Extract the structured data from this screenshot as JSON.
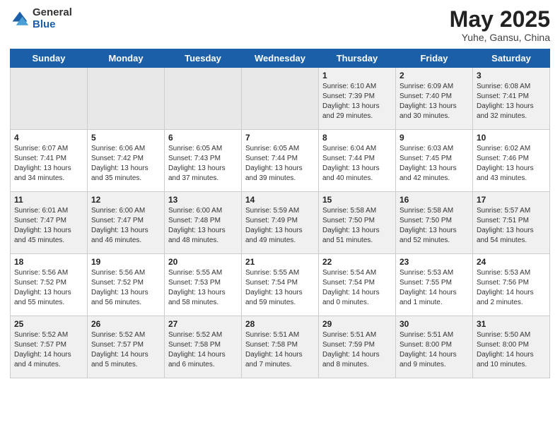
{
  "header": {
    "logo_general": "General",
    "logo_blue": "Blue",
    "month_title": "May 2025",
    "location": "Yuhe, Gansu, China"
  },
  "weekdays": [
    "Sunday",
    "Monday",
    "Tuesday",
    "Wednesday",
    "Thursday",
    "Friday",
    "Saturday"
  ],
  "weeks": [
    [
      {
        "day": "",
        "info": ""
      },
      {
        "day": "",
        "info": ""
      },
      {
        "day": "",
        "info": ""
      },
      {
        "day": "",
        "info": ""
      },
      {
        "day": "1",
        "info": "Sunrise: 6:10 AM\nSunset: 7:39 PM\nDaylight: 13 hours\nand 29 minutes."
      },
      {
        "day": "2",
        "info": "Sunrise: 6:09 AM\nSunset: 7:40 PM\nDaylight: 13 hours\nand 30 minutes."
      },
      {
        "day": "3",
        "info": "Sunrise: 6:08 AM\nSunset: 7:41 PM\nDaylight: 13 hours\nand 32 minutes."
      }
    ],
    [
      {
        "day": "4",
        "info": "Sunrise: 6:07 AM\nSunset: 7:41 PM\nDaylight: 13 hours\nand 34 minutes."
      },
      {
        "day": "5",
        "info": "Sunrise: 6:06 AM\nSunset: 7:42 PM\nDaylight: 13 hours\nand 35 minutes."
      },
      {
        "day": "6",
        "info": "Sunrise: 6:05 AM\nSunset: 7:43 PM\nDaylight: 13 hours\nand 37 minutes."
      },
      {
        "day": "7",
        "info": "Sunrise: 6:05 AM\nSunset: 7:44 PM\nDaylight: 13 hours\nand 39 minutes."
      },
      {
        "day": "8",
        "info": "Sunrise: 6:04 AM\nSunset: 7:44 PM\nDaylight: 13 hours\nand 40 minutes."
      },
      {
        "day": "9",
        "info": "Sunrise: 6:03 AM\nSunset: 7:45 PM\nDaylight: 13 hours\nand 42 minutes."
      },
      {
        "day": "10",
        "info": "Sunrise: 6:02 AM\nSunset: 7:46 PM\nDaylight: 13 hours\nand 43 minutes."
      }
    ],
    [
      {
        "day": "11",
        "info": "Sunrise: 6:01 AM\nSunset: 7:47 PM\nDaylight: 13 hours\nand 45 minutes."
      },
      {
        "day": "12",
        "info": "Sunrise: 6:00 AM\nSunset: 7:47 PM\nDaylight: 13 hours\nand 46 minutes."
      },
      {
        "day": "13",
        "info": "Sunrise: 6:00 AM\nSunset: 7:48 PM\nDaylight: 13 hours\nand 48 minutes."
      },
      {
        "day": "14",
        "info": "Sunrise: 5:59 AM\nSunset: 7:49 PM\nDaylight: 13 hours\nand 49 minutes."
      },
      {
        "day": "15",
        "info": "Sunrise: 5:58 AM\nSunset: 7:50 PM\nDaylight: 13 hours\nand 51 minutes."
      },
      {
        "day": "16",
        "info": "Sunrise: 5:58 AM\nSunset: 7:50 PM\nDaylight: 13 hours\nand 52 minutes."
      },
      {
        "day": "17",
        "info": "Sunrise: 5:57 AM\nSunset: 7:51 PM\nDaylight: 13 hours\nand 54 minutes."
      }
    ],
    [
      {
        "day": "18",
        "info": "Sunrise: 5:56 AM\nSunset: 7:52 PM\nDaylight: 13 hours\nand 55 minutes."
      },
      {
        "day": "19",
        "info": "Sunrise: 5:56 AM\nSunset: 7:52 PM\nDaylight: 13 hours\nand 56 minutes."
      },
      {
        "day": "20",
        "info": "Sunrise: 5:55 AM\nSunset: 7:53 PM\nDaylight: 13 hours\nand 58 minutes."
      },
      {
        "day": "21",
        "info": "Sunrise: 5:55 AM\nSunset: 7:54 PM\nDaylight: 13 hours\nand 59 minutes."
      },
      {
        "day": "22",
        "info": "Sunrise: 5:54 AM\nSunset: 7:54 PM\nDaylight: 14 hours\nand 0 minutes."
      },
      {
        "day": "23",
        "info": "Sunrise: 5:53 AM\nSunset: 7:55 PM\nDaylight: 14 hours\nand 1 minute."
      },
      {
        "day": "24",
        "info": "Sunrise: 5:53 AM\nSunset: 7:56 PM\nDaylight: 14 hours\nand 2 minutes."
      }
    ],
    [
      {
        "day": "25",
        "info": "Sunrise: 5:52 AM\nSunset: 7:57 PM\nDaylight: 14 hours\nand 4 minutes."
      },
      {
        "day": "26",
        "info": "Sunrise: 5:52 AM\nSunset: 7:57 PM\nDaylight: 14 hours\nand 5 minutes."
      },
      {
        "day": "27",
        "info": "Sunrise: 5:52 AM\nSunset: 7:58 PM\nDaylight: 14 hours\nand 6 minutes."
      },
      {
        "day": "28",
        "info": "Sunrise: 5:51 AM\nSunset: 7:58 PM\nDaylight: 14 hours\nand 7 minutes."
      },
      {
        "day": "29",
        "info": "Sunrise: 5:51 AM\nSunset: 7:59 PM\nDaylight: 14 hours\nand 8 minutes."
      },
      {
        "day": "30",
        "info": "Sunrise: 5:51 AM\nSunset: 8:00 PM\nDaylight: 14 hours\nand 9 minutes."
      },
      {
        "day": "31",
        "info": "Sunrise: 5:50 AM\nSunset: 8:00 PM\nDaylight: 14 hours\nand 10 minutes."
      }
    ]
  ]
}
